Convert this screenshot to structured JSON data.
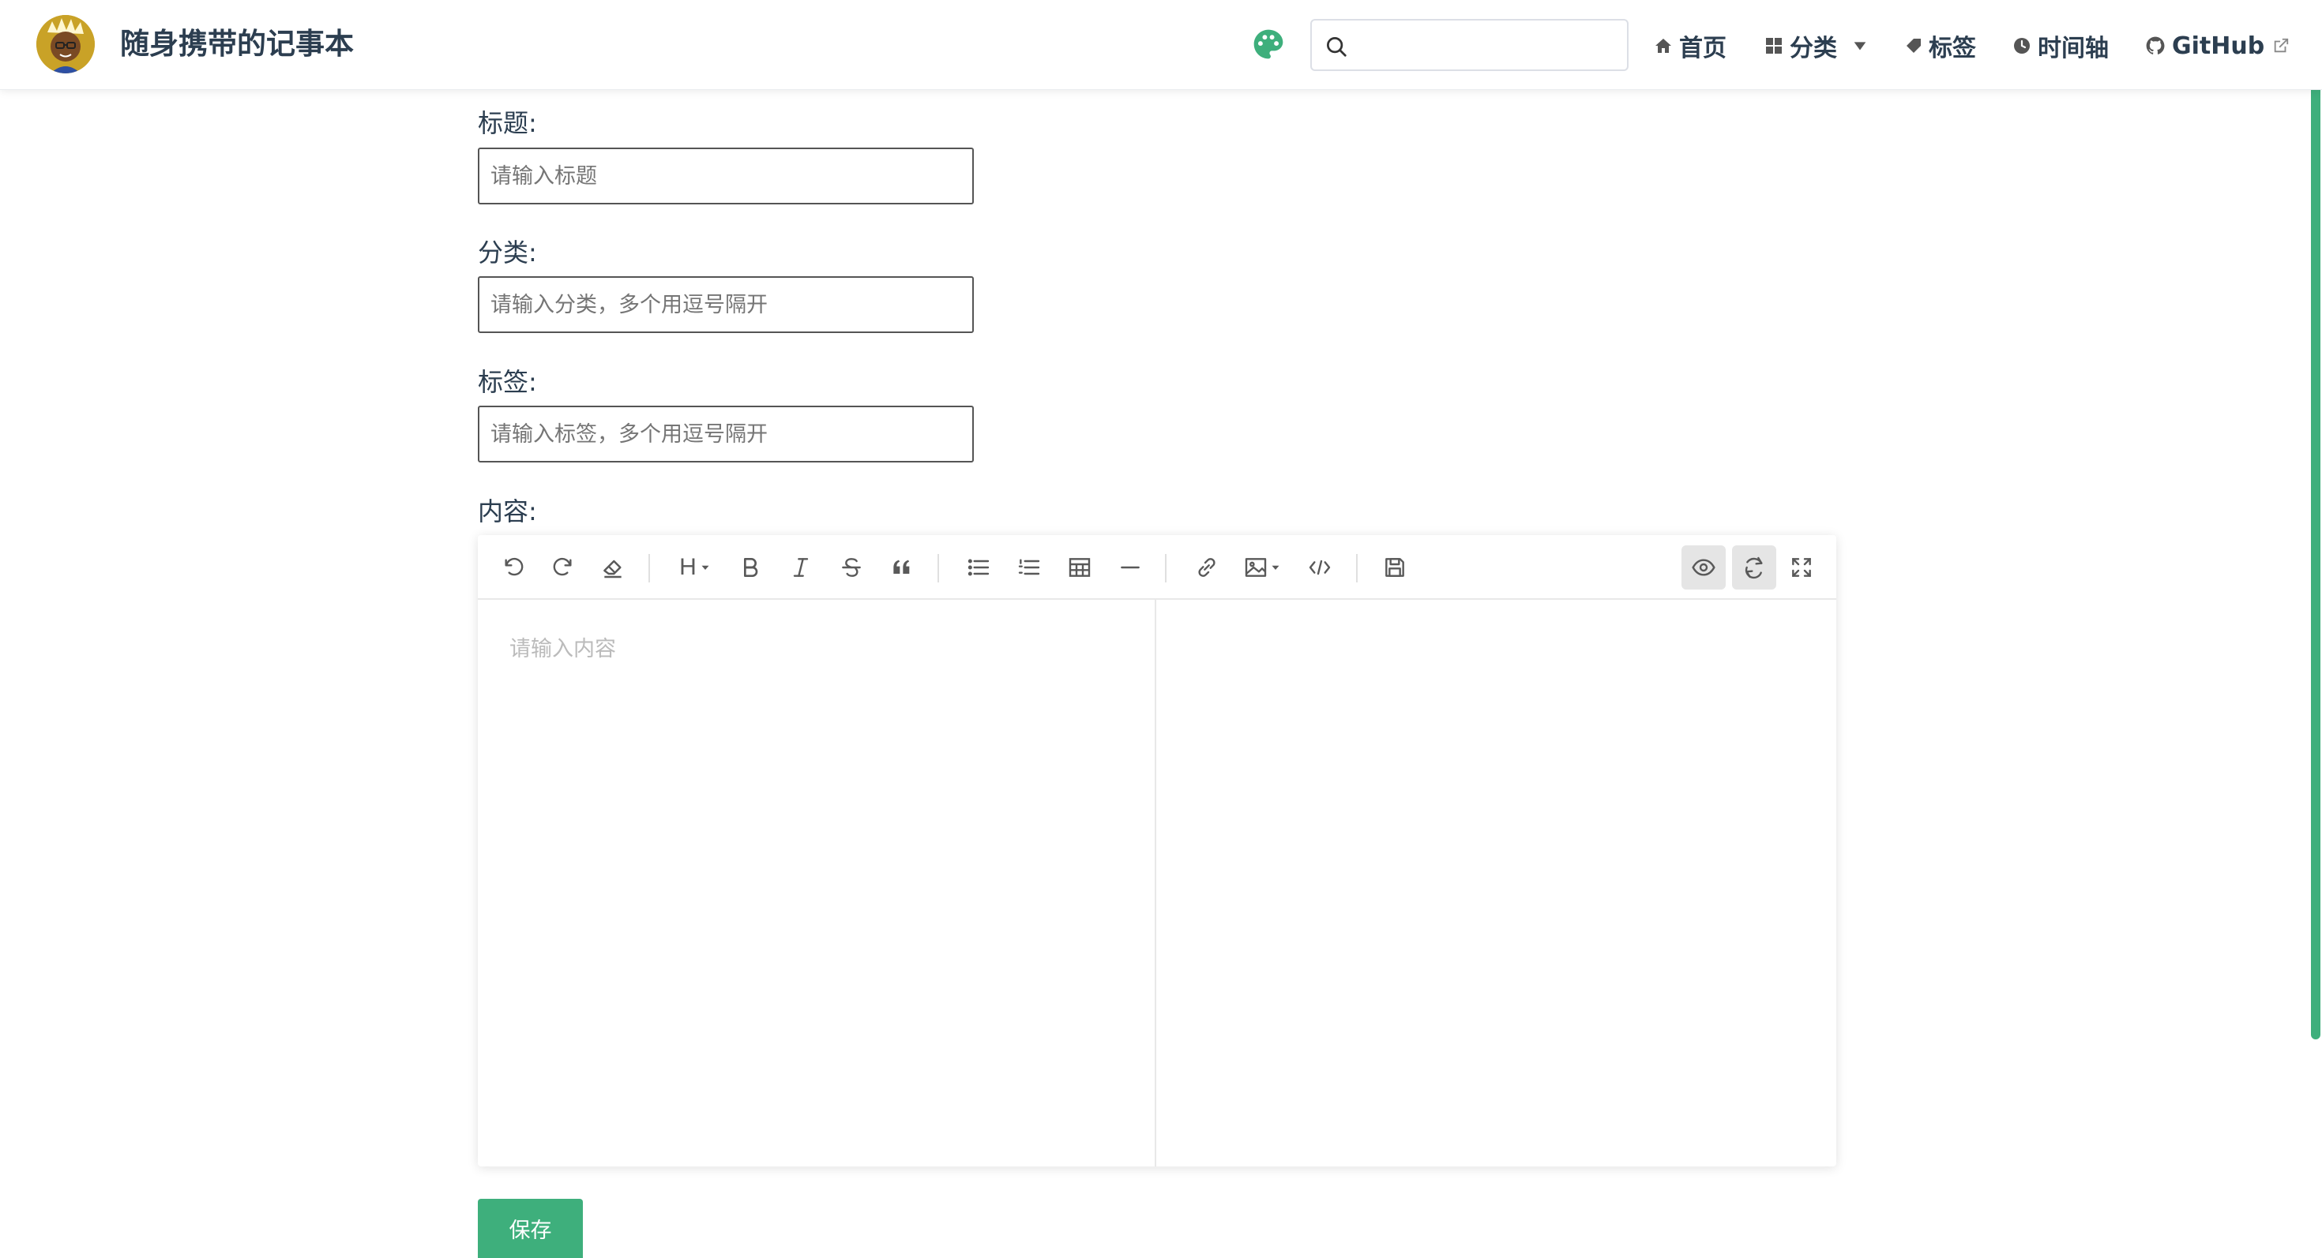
{
  "navbar": {
    "site_name": "随身携带的记事本",
    "search": {
      "value": "",
      "placeholder": ""
    },
    "links": {
      "home": "首页",
      "category": "分类",
      "tags": "标签",
      "timeline": "时间轴",
      "github": "GitHub"
    },
    "icons": [
      "avatar-logo",
      "palette-icon",
      "search-icon",
      "home-icon",
      "grid-icon",
      "chevron-down-icon",
      "tag-icon",
      "clock-icon",
      "github-icon",
      "external-link-icon"
    ]
  },
  "form": {
    "title": {
      "label": "标题:",
      "placeholder": "请输入标题",
      "value": ""
    },
    "category": {
      "label": "分类:",
      "placeholder": "请输入分类，多个用逗号隔开",
      "value": ""
    },
    "tags": {
      "label": "标签:",
      "placeholder": "请输入标签，多个用逗号隔开",
      "value": ""
    },
    "content": {
      "label": "内容:",
      "placeholder": "请输入内容",
      "value": ""
    }
  },
  "editor": {
    "toolbar": [
      "undo",
      "redo",
      "clear",
      "heading",
      "bold",
      "italic",
      "strikethrough",
      "quote",
      "unordered-list",
      "ordered-list",
      "table",
      "horizontal-rule",
      "link",
      "image",
      "code",
      "save",
      "preview",
      "sync-scroll",
      "fullscreen"
    ],
    "heading_label": "H",
    "active": [
      "preview",
      "sync-scroll"
    ]
  },
  "save_button": {
    "label": "保存"
  },
  "colors": {
    "accent": "#3eaf7c",
    "text": "#2c3e50"
  }
}
